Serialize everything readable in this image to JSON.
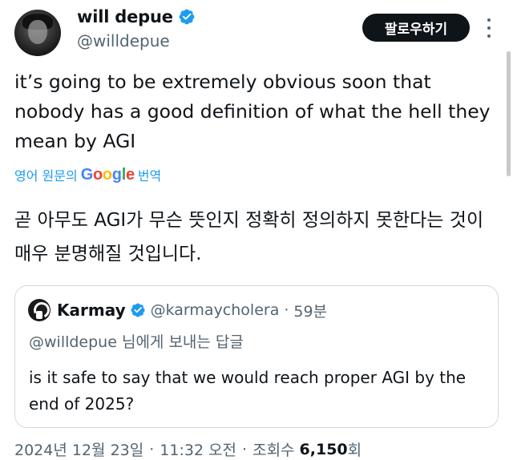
{
  "author": {
    "name": "will depue",
    "handle": "@willdepue",
    "avatar_icon": "user-avatar-photo",
    "verified_icon": "verified-badge-icon"
  },
  "actions": {
    "follow_label": "팔로우하기",
    "more_icon": "vertical-dots-icon"
  },
  "tweet": {
    "text": "it’s going to be extremely obvious soon that nobody has a good definition of what the hell they mean by AGI"
  },
  "translation": {
    "prefix": "영어 원문의",
    "brand": "Google",
    "suffix": "번역",
    "text": "곧 아무도 AGI가 무슨 뜻인지 정확히 정의하지 못한다는 것이 매우 분명해질 것입니다."
  },
  "quote": {
    "name": "Karmay",
    "handle": "@karmaycholera",
    "separator": "·",
    "time": "59분",
    "reply_mention": "@willdepue",
    "reply_suffix": "님에게 보내는 답글",
    "text": "is it safe to say that we would reach proper AGI by the end of 2025?"
  },
  "meta": {
    "date": "2024년 12월 23일",
    "separator": "·",
    "time": "11:32 오전",
    "views_label": "조회수",
    "views_count": "6,150",
    "views_suffix": "회"
  },
  "colors": {
    "accent": "#1d9bf0",
    "text": "#0f1419",
    "secondary": "#536471",
    "border": "#cfd9de",
    "button_bg": "#0f1419",
    "google_blue": "#4285f4",
    "google_red": "#ea4335",
    "google_yellow": "#fbbc05",
    "google_green": "#34a853"
  }
}
